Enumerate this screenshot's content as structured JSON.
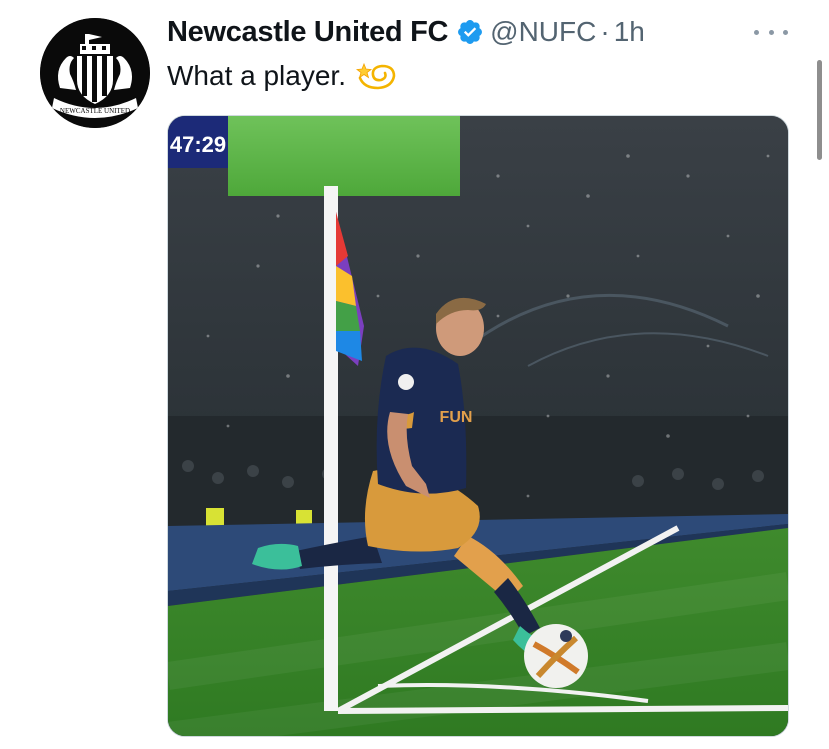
{
  "tweet": {
    "display_name": "Newcastle United FC",
    "handle": "@NUFC",
    "separator": "·",
    "time": "1h",
    "verified": true,
    "text": "What a player.",
    "emoji": "dizzy-icon",
    "avatar_logo_text": "NEWCASTLE UNITED"
  },
  "media": {
    "scoreboard_time": "47:29",
    "shirt_sponsor": "FUN",
    "description_icons": [
      "corner-flag",
      "player",
      "ball"
    ]
  },
  "colors": {
    "verified_blue": "#1d9bf0",
    "name_text": "#0f1419",
    "secondary_text": "#536471",
    "pitch_green": "#3a8f2e"
  }
}
